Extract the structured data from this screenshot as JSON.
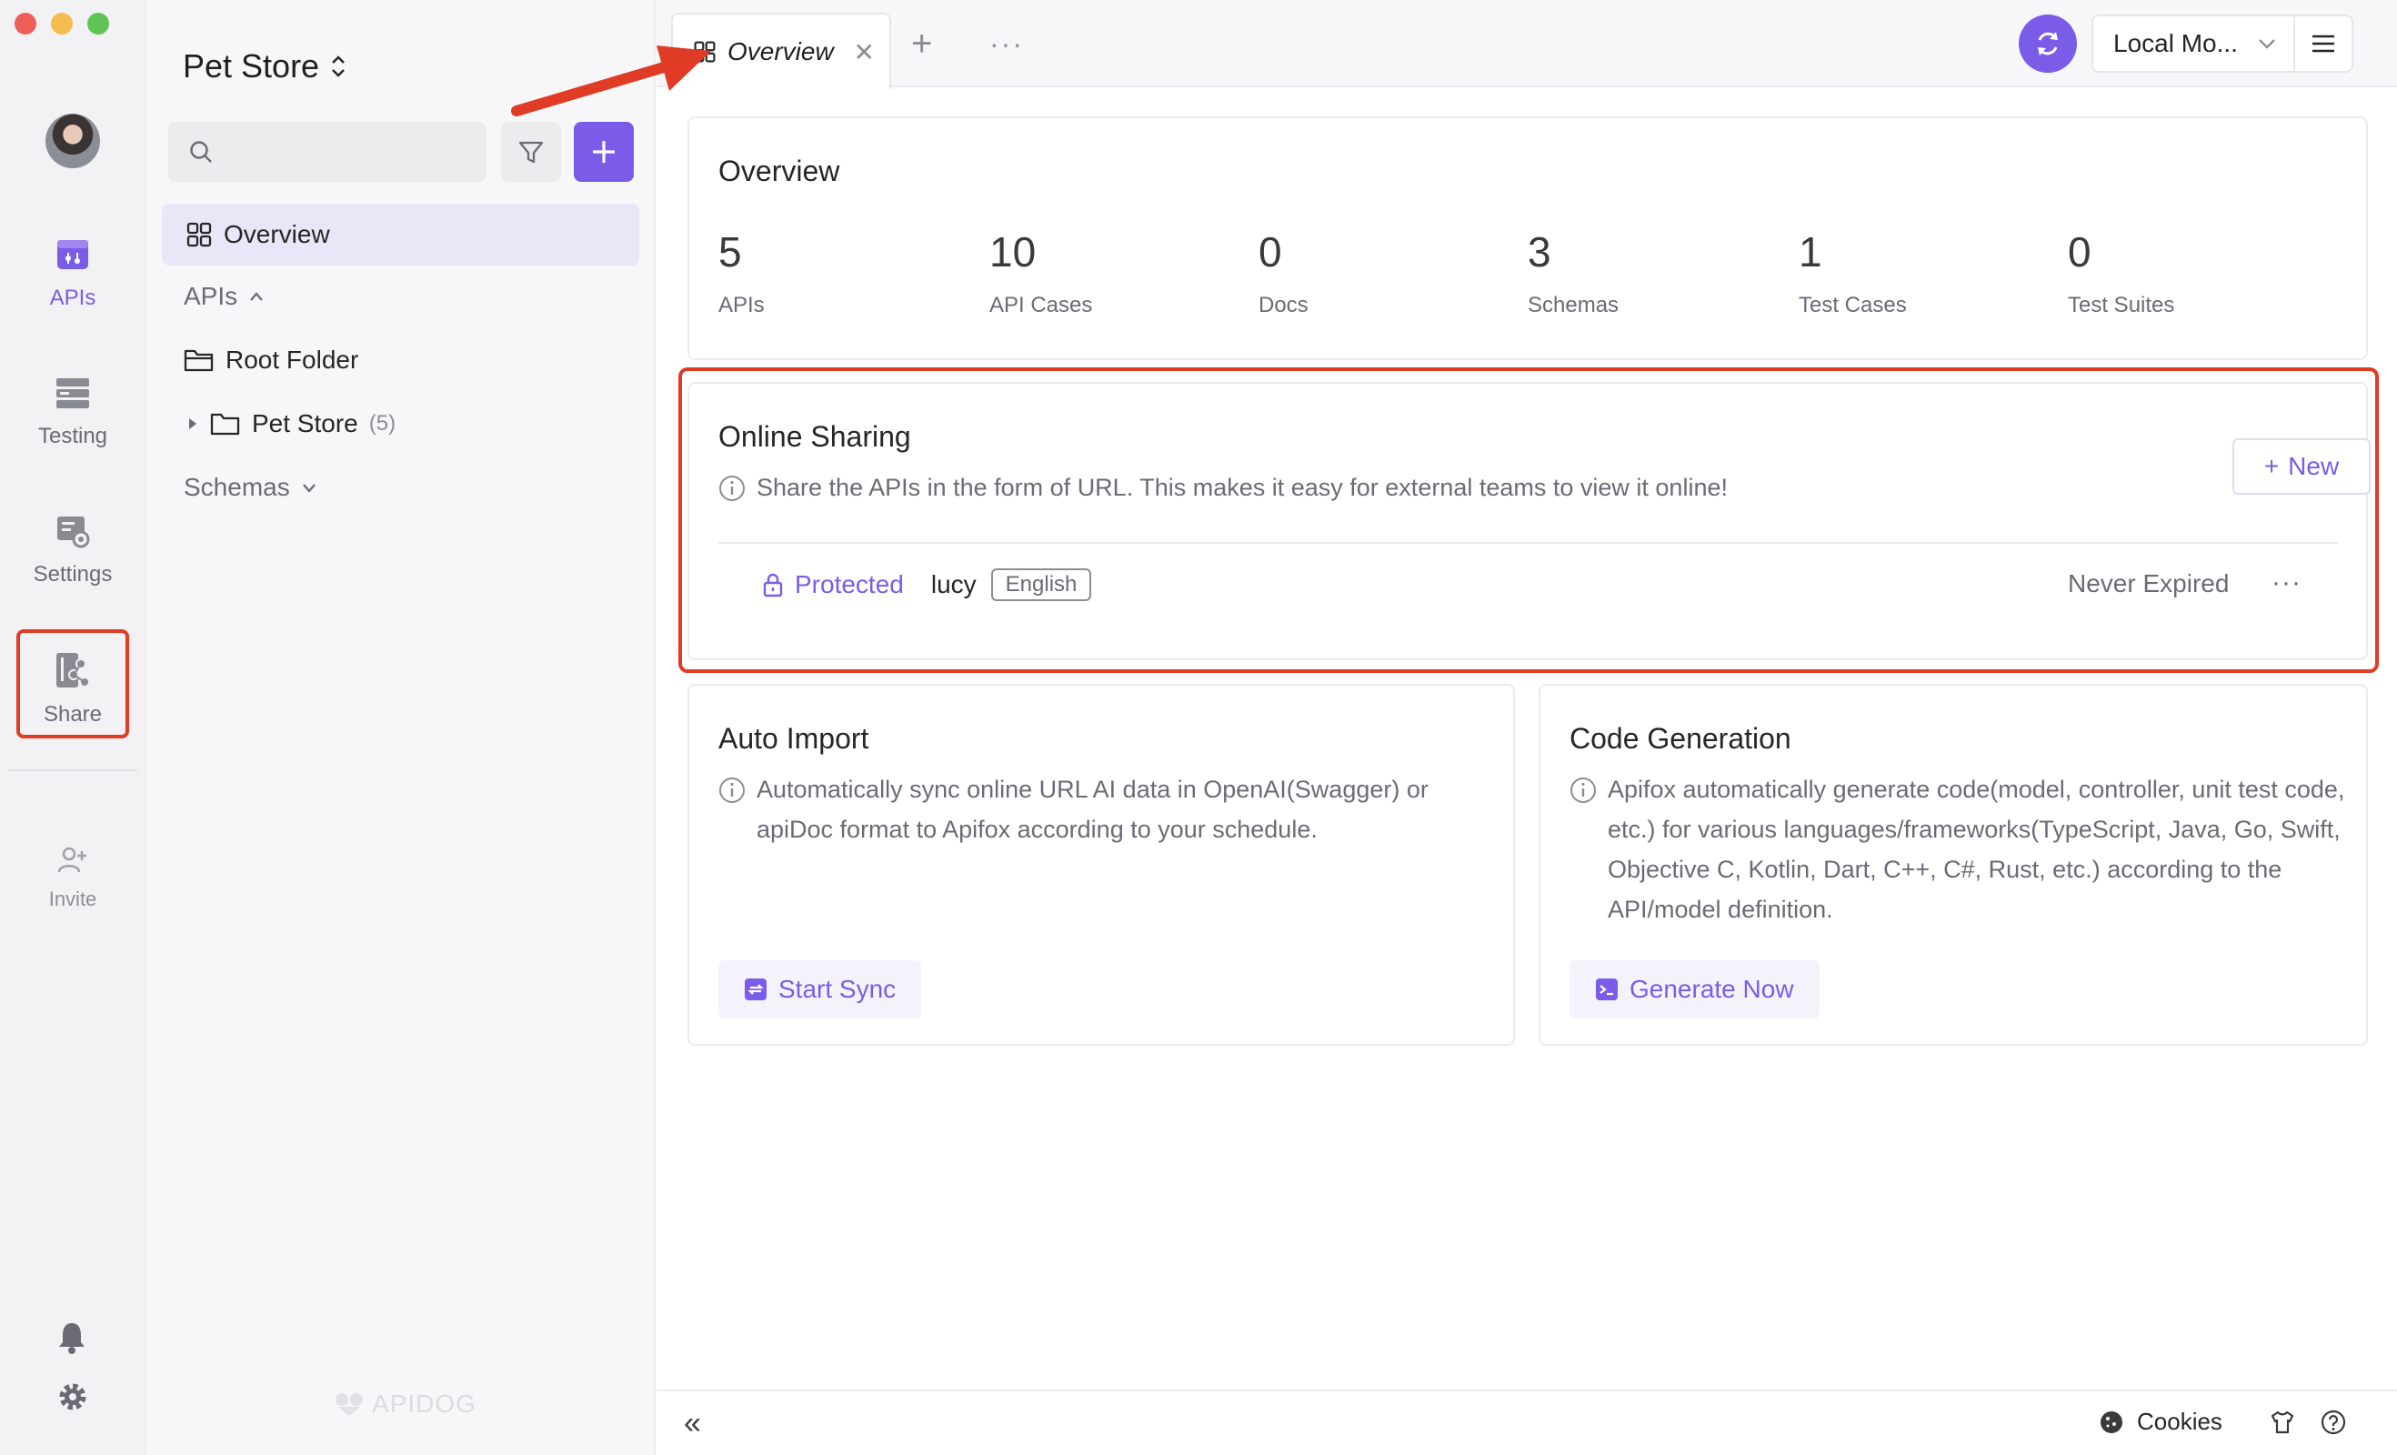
{
  "window": {
    "traffic_lights": [
      "#ee5f57",
      "#f5bd4f",
      "#5fc454"
    ]
  },
  "rail": {
    "items": [
      {
        "label": "APIs",
        "icon": "apis-icon",
        "active": true
      },
      {
        "label": "Testing",
        "icon": "testing-icon",
        "active": false
      },
      {
        "label": "Settings",
        "icon": "settings-icon",
        "active": false
      },
      {
        "label": "Share",
        "icon": "share-icon",
        "active": false,
        "highlighted": true
      }
    ],
    "invite_label": "Invite",
    "accent": "#7a5ce6"
  },
  "tree": {
    "project_name": "Pet Store",
    "search_placeholder": "",
    "overview_label": "Overview",
    "apis_section": "APIs",
    "root_folder": "Root Folder",
    "pet_store_folder": "Pet Store",
    "pet_store_count": "(5)",
    "schemas_section": "Schemas",
    "brand": "APIDOG"
  },
  "tabs": {
    "active_label": "Overview",
    "environment": "Local Mo..."
  },
  "overview": {
    "title": "Overview",
    "stats": [
      {
        "value": "5",
        "label": "APIs"
      },
      {
        "value": "10",
        "label": "API Cases"
      },
      {
        "value": "0",
        "label": "Docs"
      },
      {
        "value": "3",
        "label": "Schemas"
      },
      {
        "value": "1",
        "label": "Test Cases"
      },
      {
        "value": "0",
        "label": "Test Suites"
      }
    ]
  },
  "sharing": {
    "title": "Online Sharing",
    "description": "Share the APIs in the form of URL. This makes it easy for external teams to view it online!",
    "new_button": "New",
    "row": {
      "access": "Protected",
      "user": "lucy",
      "language": "English",
      "expiry": "Never Expired"
    }
  },
  "auto_import": {
    "title": "Auto Import",
    "description": "Automatically sync online URL AI data in OpenAI(Swagger) or apiDoc format to Apifox according to your schedule.",
    "button": "Start Sync"
  },
  "code_gen": {
    "title": "Code Generation",
    "description": "Apifox automatically generate code(model, controller, unit test code, etc.) for various languages/frameworks(TypeScript, Java, Go, Swift, Objective C, Kotlin, Dart, C++, C#, Rust, etc.) according to the API/model definition.",
    "button": "Generate Now"
  },
  "statusbar": {
    "cookies_label": "Cookies"
  },
  "colors": {
    "primary": "#7b5ce8",
    "annotation_red": "#e03b24"
  }
}
